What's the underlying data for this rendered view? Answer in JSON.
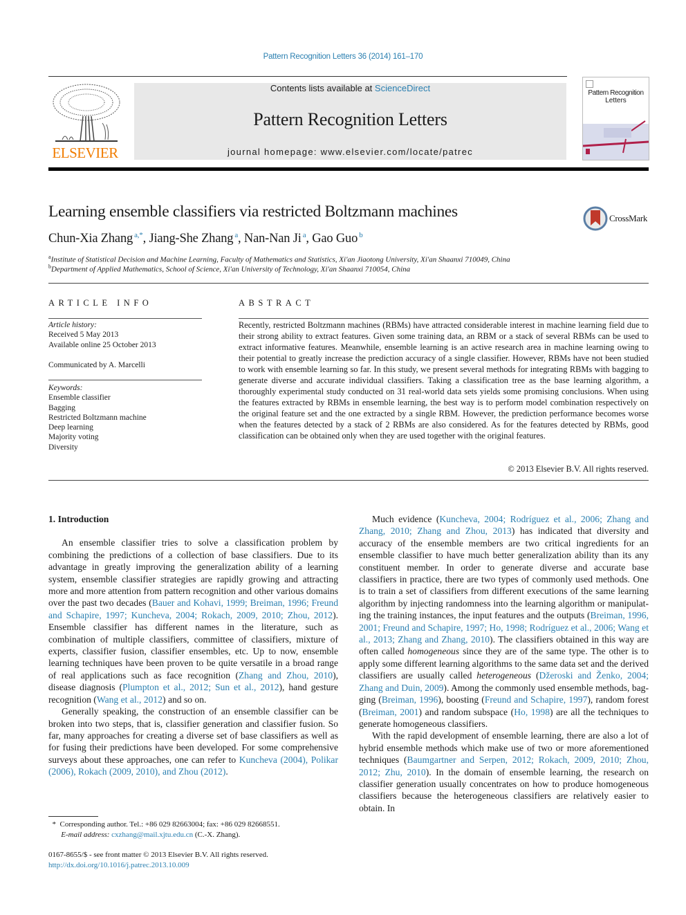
{
  "header": {
    "journal_ref": "Pattern Recognition Letters 36 (2014) 161–170",
    "contents_prefix": "Contents lists available at ",
    "contents_link": "ScienceDirect",
    "journal_name": "Pattern Recognition Letters",
    "homepage": "journal homepage: www.elsevier.com/locate/patrec",
    "publisher_logo_text": "ELSEVIER",
    "cover_title_line1": "Pattern Recognition",
    "cover_title_line2": "Letters",
    "colors": {
      "link": "#2a7fb0",
      "elsevier_orange": "#f07c00",
      "masthead_bg": "#e8e8e8"
    }
  },
  "article": {
    "title": "Learning ensemble classifiers via restricted Boltzmann machines",
    "crossmark_label": "CrossMark",
    "authors": [
      {
        "name": "Chun-Xia Zhang",
        "sup": "a,*"
      },
      {
        "name": "Jiang-She Zhang",
        "sup": "a"
      },
      {
        "name": "Nan-Nan Ji",
        "sup": "a"
      },
      {
        "name": "Gao Guo",
        "sup": "b"
      }
    ],
    "affiliations": [
      {
        "mark": "a",
        "text": "Institute of Statistical Decision and Machine Learning, Faculty of Mathematics and Statistics, Xi'an Jiaotong University, Xi'an Shaanxi 710049, China"
      },
      {
        "mark": "b",
        "text": "Department of Applied Mathematics, School of Science, Xi'an University of Technology, Xi'an Shaanxi 710054, China"
      }
    ]
  },
  "article_info": {
    "heading": "ARTICLE INFO",
    "history_label": "Article history:",
    "received": "Received 5 May 2013",
    "available": "Available online 25 October 2013",
    "communicated": "Communicated by A. Marcelli",
    "keywords_label": "Keywords:",
    "keywords": [
      "Ensemble classifier",
      "Bagging",
      "Restricted Boltzmann machine",
      "Deep learning",
      "Majority voting",
      "Diversity"
    ]
  },
  "abstract": {
    "heading": "ABSTRACT",
    "text": "Recently, restricted Boltzmann machines (RBMs) have attracted considerable interest in machine learn­ing field due to their strong ability to extract features. Given some training data, an RBM or a stack of sev­eral RBMs can be used to extract informative features. Meanwhile, ensemble learning is an active research area in machine learning owing to their potential to greatly increase the prediction accuracy of a single classifier. However, RBMs have not been studied to work with ensemble learning so far. In this study, we present several methods for integrating RBMs with bagging to generate diverse and accurate individual classifiers. Taking a classification tree as the base learning algorithm, a thoroughly experimen­tal study conducted on 31 real-world data sets yields some promising conclusions. When using the fea­tures extracted by RBMs in ensemble learning, the best way is to perform model combination respectively on the original feature set and the one extracted by a single RBM. However, the prediction performance becomes worse when the features detected by a stack of 2 RBMs are also considered. As for the features detected by RBMs, good classification can be obtained only when they are used together with the original features.",
    "copyright": "© 2013 Elsevier B.V. All rights reserved."
  },
  "body": {
    "section_heading": "1. Introduction",
    "left_paragraphs": [
      [
        {
          "t": "An ensemble classifier tries to solve a classification problem by combining the predictions of a collection of base classifiers. Due to its advantage in greatly improving the generalization ability of a learning system, ensemble classifier strategies are rapidly growing and attracting more and more attention from pattern recognition and other various domains over the past two decades ("
        },
        {
          "t": "Bauer and Kohavi, 1999; Breiman, 1996; Freund and Schapire, 1997; Kuncheva, 2004; Rokach, 2009, 2010; Zhou, 2012",
          "link": true
        },
        {
          "t": "). Ensemble classifier has different names in the literature, such as combination of multiple classifiers, committee of classifiers, mixture of experts, classifier fusion, classifier ensembles, etc. Up to now, ensemble learning techniques have been proven to be quite versatile in a broad range of real applications such as face recognition ("
        },
        {
          "t": "Zhang and Zhou, 2010",
          "link": true
        },
        {
          "t": "), disease diagnosis ("
        },
        {
          "t": "Plumpton et al., 2012; Sun et al., 2012",
          "link": true
        },
        {
          "t": "), hand gesture recognition ("
        },
        {
          "t": "Wang et al., 2012",
          "link": true
        },
        {
          "t": ") and so on."
        }
      ],
      [
        {
          "t": "Generally speaking, the construction of an ensemble classifier can be broken into two steps, that is, classifier generation and clas­sifier fusion. So far, many approaches for creating a diverse set of base classifiers as well as for fusing their predictions have been developed. For some comprehensive surveys about these ap­proaches, one can refer to "
        },
        {
          "t": "Kuncheva (2004), Polikar (2006), Rokach (2009, 2010), and Zhou (2012)",
          "link": true
        },
        {
          "t": "."
        }
      ]
    ],
    "right_paragraphs": [
      [
        {
          "t": "Much evidence ("
        },
        {
          "t": "Kuncheva, 2004; Rodríguez et al., 2006; Zhang and Zhang, 2010; Zhang and Zhou, 2013",
          "link": true
        },
        {
          "t": ") has indicated that diver­sity and accuracy of the ensemble members are two critical ingre­dients for an ensemble classifier to have much better generalization ability than its any constituent member. In order to generate diverse and accurate base classifiers in practice, there are two types of commonly used methods. One is to train a set of classifiers from different executions of the same learning algorithm by injecting randomness into the learning algorithm or manipulat­ing the training instances, the input features and the outputs ("
        },
        {
          "t": "Breiman, 1996, 2001; Freund and Schapire, 1997; Ho, 1998; Rodríguez et al., 2006; Wang et al., 2013; Zhang and Zhang, 2010",
          "link": true
        },
        {
          "t": "). The clas­sifiers obtained in this way are often called "
        },
        {
          "t": "homogeneous",
          "italic": true
        },
        {
          "t": " since they are of the same type. The other is to apply some different learning algorithms to the same data set and the derived classifiers are usu­ally called "
        },
        {
          "t": "heterogeneous",
          "italic": true
        },
        {
          "t": " ("
        },
        {
          "t": "Džeroski and Ženko, 2004; Zhang and Duin, 2009",
          "link": true
        },
        {
          "t": "). Among the commonly used ensemble methods, bag­ging ("
        },
        {
          "t": "Breiman, 1996",
          "link": true
        },
        {
          "t": "), boosting ("
        },
        {
          "t": "Freund and Schapire, 1997",
          "link": true
        },
        {
          "t": "), ran­dom forest ("
        },
        {
          "t": "Breiman, 2001",
          "link": true
        },
        {
          "t": ") and random subspace ("
        },
        {
          "t": "Ho, 1998",
          "link": true
        },
        {
          "t": ") are all the techniques to generate homogeneous classifiers."
        }
      ],
      [
        {
          "t": "With the rapid development of ensemble learning, there are also a lot of hybrid ensemble methods which make use of two or more aforementioned techniques ("
        },
        {
          "t": "Baumgartner and Serpen, 2012; Rokach, 2009, 2010; Zhou, 2012; Zhu, 2010",
          "link": true
        },
        {
          "t": "). In the domain of ensemble learning, the research on classifier generation usually concentrates on how to produce homogeneous classifiers because the heterogeneous classifiers are relatively easier to obtain. In"
        }
      ]
    ]
  },
  "footnote": {
    "marker": "*",
    "corresponding": "Corresponding author. Tel.: +86 029 82663004; fax: +86 029 82668551.",
    "email_label": "E-mail address:",
    "email": "cxzhang@mail.xjtu.edu.cn",
    "email_suffix": " (C.-X. Zhang)."
  },
  "front_matter": {
    "issn_line": "0167-8655/$ - see front matter © 2013 Elsevier B.V. All rights reserved.",
    "doi": "http://dx.doi.org/10.1016/j.patrec.2013.10.009"
  }
}
